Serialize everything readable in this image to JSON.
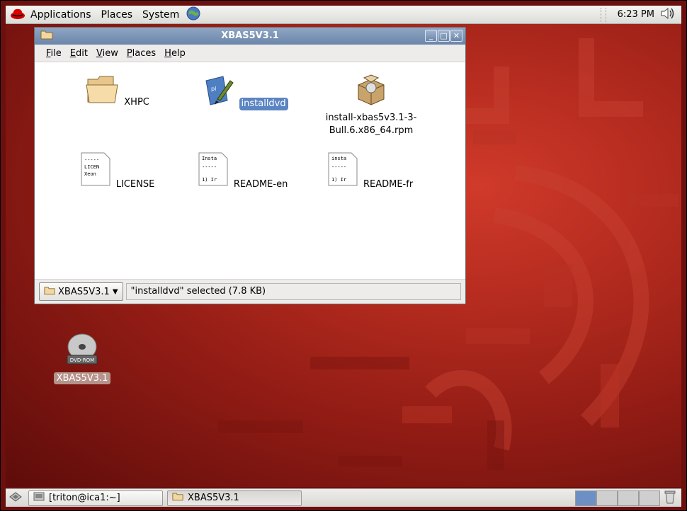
{
  "top_panel": {
    "menus": [
      "Applications",
      "Places",
      "System"
    ],
    "clock": "6:23 PM"
  },
  "window": {
    "title": "XBAS5V3.1",
    "menu": [
      {
        "label": "File",
        "accel": "F",
        "rest": "ile"
      },
      {
        "label": "Edit",
        "accel": "E",
        "rest": "dit"
      },
      {
        "label": "View",
        "accel": "V",
        "rest": "iew"
      },
      {
        "label": "Places",
        "accel": "P",
        "rest": "laces"
      },
      {
        "label": "Help",
        "accel": "H",
        "rest": "elp"
      }
    ],
    "files": [
      {
        "name": "XHPC",
        "type": "folder-icon",
        "selected": false
      },
      {
        "name": "installdvd",
        "type": "script-icon",
        "selected": true
      },
      {
        "name": "install-xbas5v3.1-3-\nBull.6.x86_64.rpm",
        "type": "package-icon",
        "selected": false
      },
      {
        "name": "LICENSE",
        "type": "text-file-icon",
        "selected": false,
        "preview": [
          "-----",
          "LICEN",
          "Xeon"
        ]
      },
      {
        "name": "README-en",
        "type": "text-file-icon",
        "selected": false,
        "preview": [
          "Insta",
          "-----",
          "1) Ir"
        ]
      },
      {
        "name": "README-fr",
        "type": "text-file-icon",
        "selected": false,
        "preview": [
          "insta",
          "-----",
          "1) Ir"
        ]
      }
    ],
    "statusbar": {
      "location": "XBAS5V3.1",
      "status": "\"installdvd\" selected (7.8 KB)"
    }
  },
  "desktop": {
    "dvd_label": "XBAS5V3.1",
    "dvd_badge": "DVD-ROM"
  },
  "bottom_panel": {
    "tasks": [
      "[triton@ica1:~]",
      "XBAS5V3.1"
    ]
  }
}
